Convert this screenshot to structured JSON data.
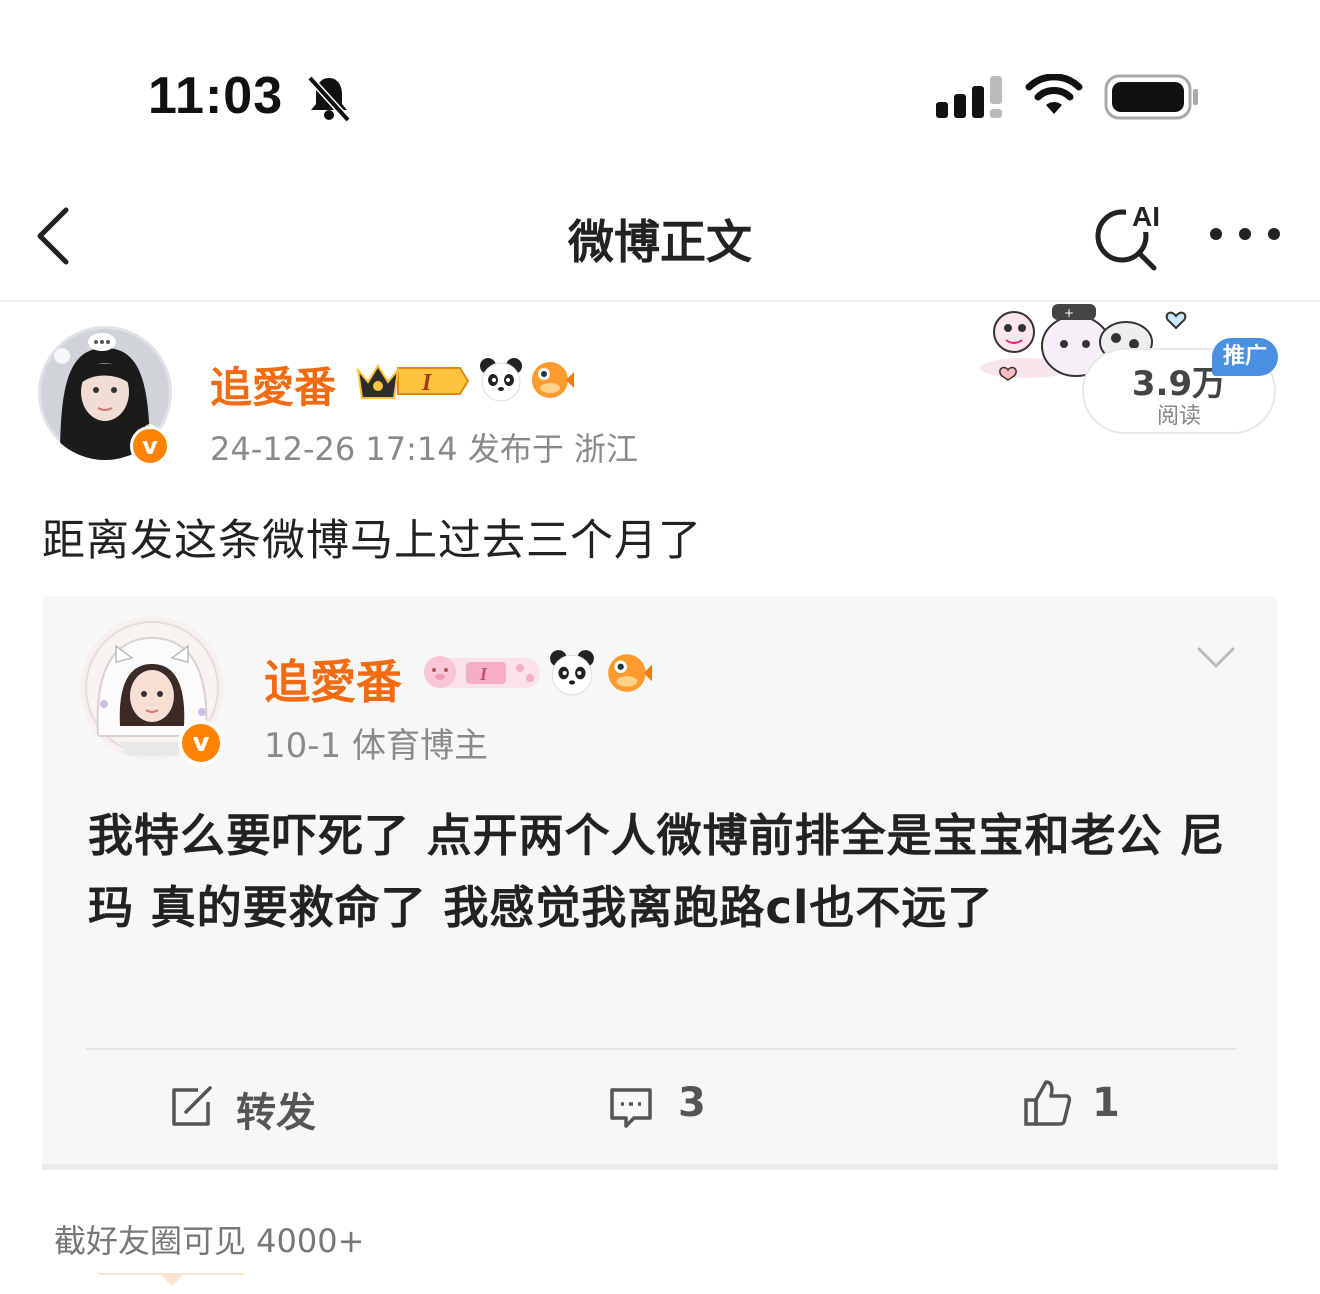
{
  "status_bar": {
    "time": "11:03"
  },
  "nav": {
    "title": "微博正文"
  },
  "post": {
    "author": "追愛番",
    "meta": "24-12-26 17:14  发布于 浙江",
    "reads_count": "3.9万",
    "reads_label": "阅读",
    "promo_label": "推广",
    "verified_mark": "v",
    "text": "距离发这条微博马上过去三个月了"
  },
  "quote": {
    "author": "追愛番",
    "meta": "10-1  体育博主",
    "verified_mark": "v",
    "text": "我特么要吓死了 点开两个人微博前排全是宝宝和老公 尼玛 真的要救命了 我感觉我离跑路cl也不远了"
  },
  "actions": {
    "repost_label": "转发",
    "comment_count": "3",
    "like_count": "1"
  },
  "footer": {
    "friends_text": "截好友圈可见 4000+"
  },
  "colors": {
    "accent_orange": "#f36b11",
    "verified_orange": "#ff8200",
    "promo_blue": "#4a90e2"
  }
}
